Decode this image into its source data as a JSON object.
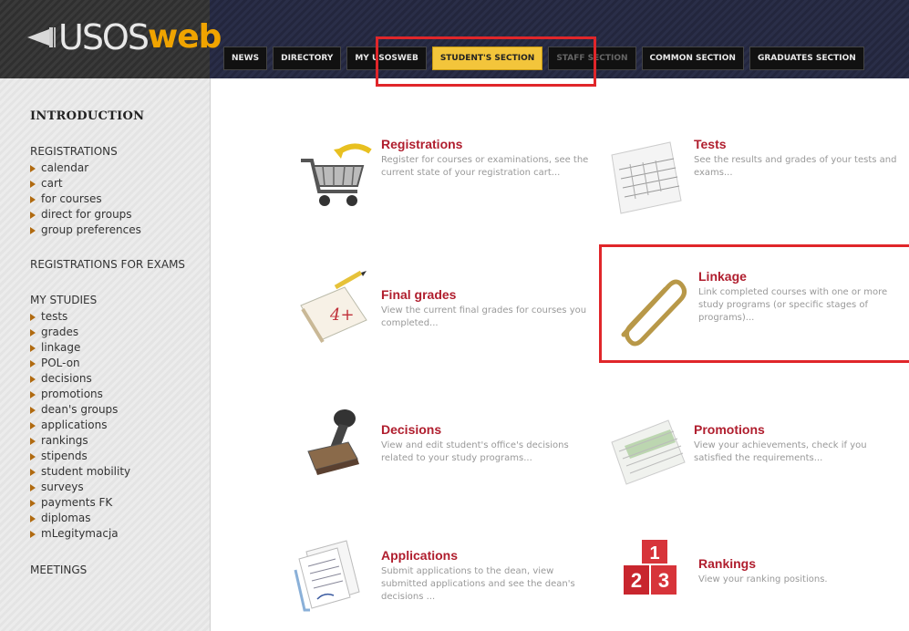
{
  "logo": {
    "left": "USOS",
    "right": "web"
  },
  "tabs": [
    {
      "label": "NEWS",
      "state": "normal"
    },
    {
      "label": "DIRECTORY",
      "state": "normal"
    },
    {
      "label": "MY USOSWEB",
      "state": "normal"
    },
    {
      "label": "STUDENT'S SECTION",
      "state": "active"
    },
    {
      "label": "STAFF SECTION",
      "state": "dim"
    },
    {
      "label": "COMMON SECTION",
      "state": "normal"
    },
    {
      "label": "GRADUATES SECTION",
      "state": "normal"
    }
  ],
  "sidebar": {
    "intro": "INTRODUCTION",
    "registrations": {
      "label": "REGISTRATIONS",
      "items": [
        "calendar",
        "cart",
        "for courses",
        "direct for groups",
        "group preferences"
      ]
    },
    "exams": "REGISTRATIONS FOR EXAMS",
    "my_studies": {
      "label": "MY STUDIES",
      "items": [
        "tests",
        "grades",
        "linkage",
        "POL-on",
        "decisions",
        "promotions",
        "dean's groups",
        "applications",
        "rankings",
        "stipends",
        "student mobility",
        "surveys",
        "payments FK",
        "diplomas",
        "mLegitymacja"
      ]
    },
    "meetings": "MEETINGS"
  },
  "tiles": {
    "registrations": {
      "title": "Registrations",
      "desc": "Register for courses or examinations, see the current state of your registration cart..."
    },
    "tests": {
      "title": "Tests",
      "desc": "See the results and grades of your tests and exams..."
    },
    "final_grades": {
      "title": "Final grades",
      "desc": "View the current final grades for courses you completed..."
    },
    "linkage": {
      "title": "Linkage",
      "desc": "Link completed courses with one or more study programs (or specific stages of programs)..."
    },
    "decisions": {
      "title": "Decisions",
      "desc": "View and edit student's office's decisions related to your study programs..."
    },
    "promotions": {
      "title": "Promotions",
      "desc": "View your achievements, check if you satisfied the requirements..."
    },
    "applications": {
      "title": "Applications",
      "desc": "Submit applications to the dean, view submitted applications and see the dean's decisions ..."
    },
    "rankings": {
      "title": "Rankings",
      "desc": "View your ranking positions."
    }
  },
  "icon_text": {
    "grade": "4+",
    "rank_1": "1",
    "rank_2": "2",
    "rank_3": "3"
  },
  "colors": {
    "accent_red": "#b01e2e",
    "tab_active": "#f3c53b",
    "highlight_box": "#e0262a"
  }
}
